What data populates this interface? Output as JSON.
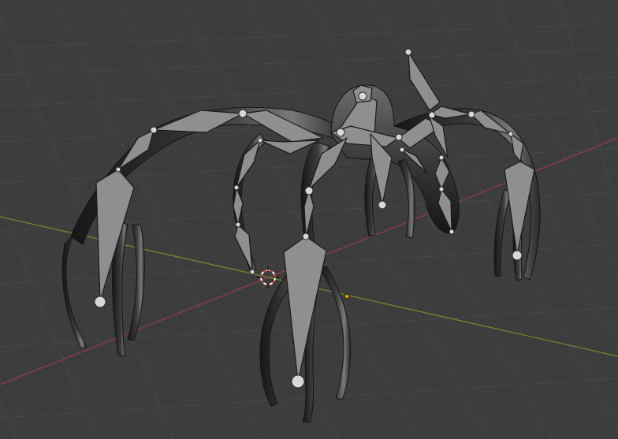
{
  "viewport": {
    "name": "3d-viewport",
    "colors": {
      "background": "#3d3d3d",
      "grid_line": "#464646",
      "x_axis": "#8c3f47",
      "y_axis": "#6b8a2e",
      "mesh_dark": "#1e1e1e",
      "mesh_mid": "#4a4a4a",
      "mesh_highlight": "#8a8a8a",
      "bone_fill": "#8f8f8f",
      "bone_stroke": "#1a1a1a",
      "joint": "#d8d8d8",
      "cursor_red": "#d23b3b",
      "origin": "#e09a1a"
    },
    "objects": [
      {
        "name": "creature-mesh",
        "type": "mesh"
      },
      {
        "name": "armature",
        "type": "armature"
      },
      {
        "name": "3d-cursor",
        "type": "cursor"
      },
      {
        "name": "object-origin",
        "type": "origin"
      }
    ]
  }
}
